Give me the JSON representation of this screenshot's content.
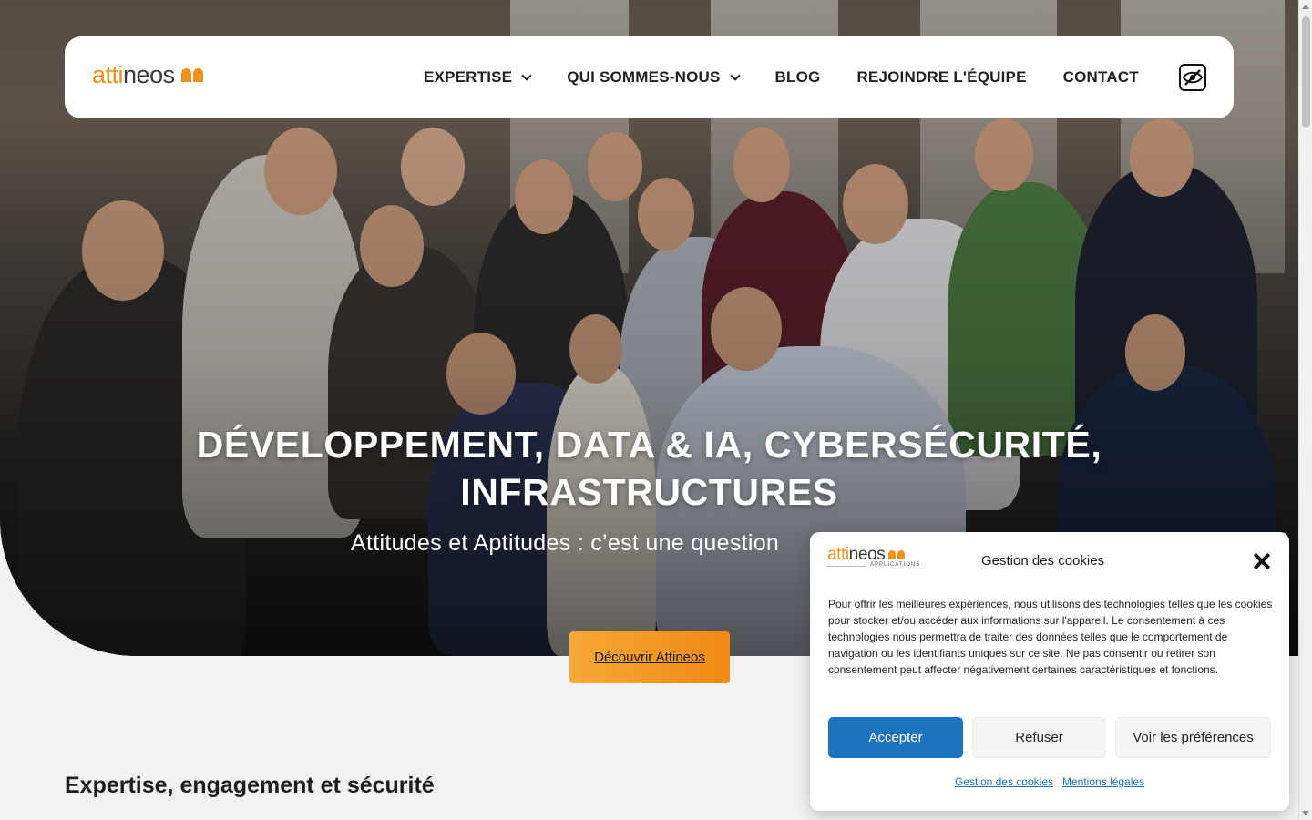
{
  "nav": {
    "logo_part1": "atti",
    "logo_part2": "neos",
    "items": [
      {
        "label": "EXPERTISE"
      },
      {
        "label": "QUI SOMMES-NOUS"
      },
      {
        "label": "BLOG"
      },
      {
        "label": "REJOINDRE L'ÉQUIPE"
      },
      {
        "label": "CONTACT"
      }
    ],
    "accessibility_icon": "eye-slash-icon"
  },
  "hero": {
    "headline_line1": "DÉVELOPPEMENT, DATA & IA, CYBERSÉCURITÉ,",
    "headline_line2": "INFRASTRUCTURES",
    "subline": "Attitudes et Aptitudes : c’est une question",
    "cta": "Découvrir Attineos"
  },
  "section": {
    "title": "Expertise, engagement et sécurité"
  },
  "cookie": {
    "logo_part1": "atti",
    "logo_part2": "neos",
    "logo_sub": "APPLICATIONS",
    "title": "Gestion des cookies",
    "body": "Pour offrir les meilleures expériences, nous utilisons des technologies telles que les cookies pour stocker et/ou accéder aux informations sur l'appareil. Le consentement à ces technologies nous permettra de traiter des données telles que le comportement de navigation ou les identifiants uniques sur ce site. Ne pas consentir ou retirer son consentement peut affecter négativement certaines caractéristiques et fonctions.",
    "accept": "Accepter",
    "refuse": "Refuser",
    "preferences": "Voir les préférences",
    "link1": "Gestion des cookies",
    "link2": "Mentions légales"
  },
  "colors": {
    "brand_orange": "#f0921a",
    "accept_blue": "#1e73be"
  }
}
